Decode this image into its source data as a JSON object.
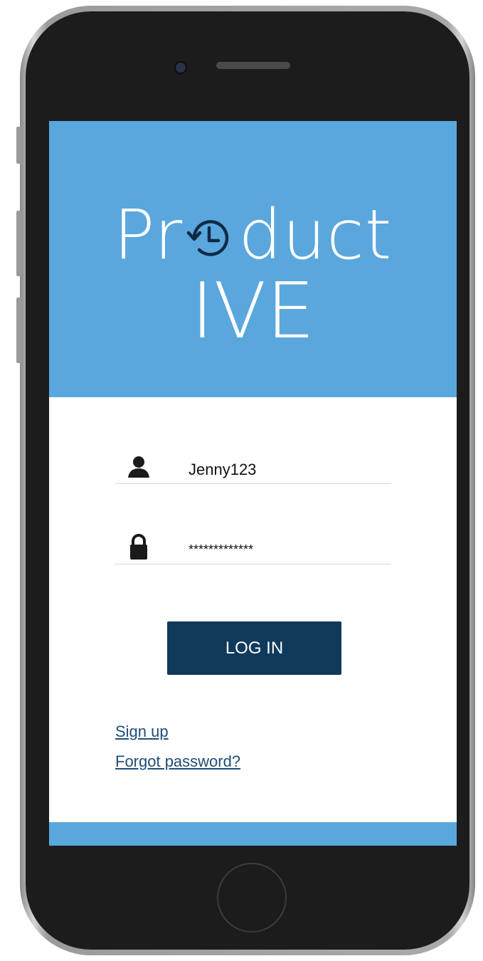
{
  "app": {
    "logo_line1_prefix": "Pr",
    "logo_line1_suffix": "duct",
    "logo_line2": "IVE",
    "logo_icon": "history-clock-icon"
  },
  "login": {
    "username_value": "Jenny123",
    "password_value": "*************",
    "username_icon": "user-icon",
    "password_icon": "lock-icon",
    "login_label": "LOG IN"
  },
  "links": {
    "signup": "Sign up",
    "forgot_password": "Forgot password?"
  },
  "colors": {
    "brand_blue": "#5aa7de",
    "button_navy": "#0f3a5c",
    "link_blue": "#1f4e79"
  }
}
